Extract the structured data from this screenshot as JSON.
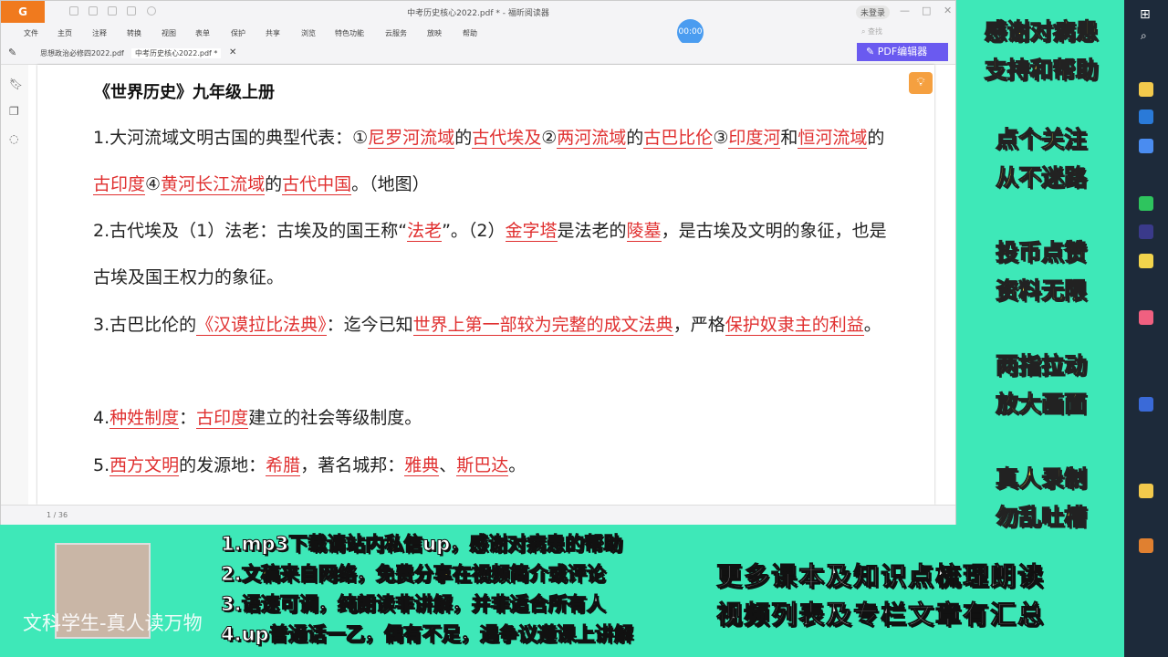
{
  "app": {
    "logo": "G",
    "title": "中考历史核心2022.pdf * - 福昕阅读器",
    "login": "未登录",
    "timer": "00:00",
    "search_placeholder": "查找",
    "pdf_editor": "PDF编辑器"
  },
  "menu": [
    "文件",
    "主页",
    "注释",
    "转换",
    "视图",
    "表单",
    "保护",
    "共享",
    "浏览",
    "特色功能",
    "云服务",
    "放映",
    "帮助"
  ],
  "tabs": [
    {
      "label": "思想政治必修四2022.pdf",
      "active": false
    },
    {
      "label": "中考历史核心2022.pdf *",
      "active": true
    }
  ],
  "document": {
    "title": "《世界历史》九年级上册",
    "paragraphs": [
      [
        {
          "t": "1.大河流域文明古国的典型代表：①"
        },
        {
          "t": "尼罗河流域",
          "hl": true
        },
        {
          "t": "的"
        },
        {
          "t": "古代埃及",
          "hl": true
        },
        {
          "t": "②"
        },
        {
          "t": "两河流域",
          "hl": true
        },
        {
          "t": "的"
        },
        {
          "t": "古巴比伦",
          "hl": true
        },
        {
          "t": "③"
        },
        {
          "t": "印度河",
          "hl": true
        },
        {
          "t": "和"
        },
        {
          "t": "恒河流域",
          "hl": true
        },
        {
          "t": "的"
        },
        {
          "t": "古印度",
          "hl": true
        },
        {
          "t": "④"
        },
        {
          "t": "黄河长江流域",
          "hl": true
        },
        {
          "t": "的"
        },
        {
          "t": "古代中国",
          "hl": true
        },
        {
          "t": "。（地图）"
        }
      ],
      [
        {
          "t": "2.古代埃及（1）法老：古埃及的国王称“"
        },
        {
          "t": "法老",
          "hl": true
        },
        {
          "t": "”。（2）"
        },
        {
          "t": "金字塔",
          "hl": true
        },
        {
          "t": "是法老的"
        },
        {
          "t": "陵墓",
          "hl": true
        },
        {
          "t": "，是古埃及文明的象征，也是古埃及国王权力的象征。"
        }
      ],
      [
        {
          "t": "3.古巴比伦的"
        },
        {
          "t": "《汉谟拉比法典》",
          "hl": true
        },
        {
          "t": "：迄今已知"
        },
        {
          "t": "世界上第一部较为完整的成文法典",
          "hl": true
        },
        {
          "t": "，严格"
        },
        {
          "t": "保护奴隶主的利益",
          "hl": true
        },
        {
          "t": "。"
        }
      ],
      [
        {
          "t": "4."
        },
        {
          "t": "种姓制度",
          "hl": true
        },
        {
          "t": "："
        },
        {
          "t": "古印度",
          "hl": true
        },
        {
          "t": "建立的社会等级制度。"
        }
      ],
      [
        {
          "t": "5."
        },
        {
          "t": "西方文明",
          "hl": true
        },
        {
          "t": "的发源地："
        },
        {
          "t": "希腊",
          "hl": true
        },
        {
          "t": "，著名城邦："
        },
        {
          "t": "雅典",
          "hl": true
        },
        {
          "t": "、"
        },
        {
          "t": "斯巴达",
          "hl": true
        },
        {
          "t": "。"
        }
      ]
    ]
  },
  "status": {
    "page": "1 / 36"
  },
  "right_banner": [
    "感谢对病患",
    "支持和帮助",
    "点个关注",
    "从不迷路",
    "投币点赞",
    "资料无限",
    "两指拉动",
    "放大画面",
    "真人录制",
    "勿乱吐槽"
  ],
  "bottom": {
    "channel": "文科学生-真人读万物",
    "lines": [
      [
        {
          "t": "1.mp3下载请"
        },
        {
          "t": "站内私信",
          "y": true
        },
        {
          "t": "up，感谢对病患的帮助"
        }
      ],
      [
        {
          "t": "2."
        },
        {
          "t": "文稿",
          "y": true
        },
        {
          "t": "来自网络，"
        },
        {
          "t": "免费分享",
          "y": true
        },
        {
          "t": "在视频简介或评论"
        }
      ],
      [
        {
          "t": "3.语速可调，纯朗读非讲解，并非适合所有人"
        }
      ],
      [
        {
          "t": "4.up普通话一乙，偶有不足，"
        },
        {
          "t": "遇争议遵课上讲解",
          "y": true
        }
      ]
    ],
    "right": [
      "更多课本及知识点梳理朗读",
      "视频列表及专栏文章有汇总"
    ]
  }
}
